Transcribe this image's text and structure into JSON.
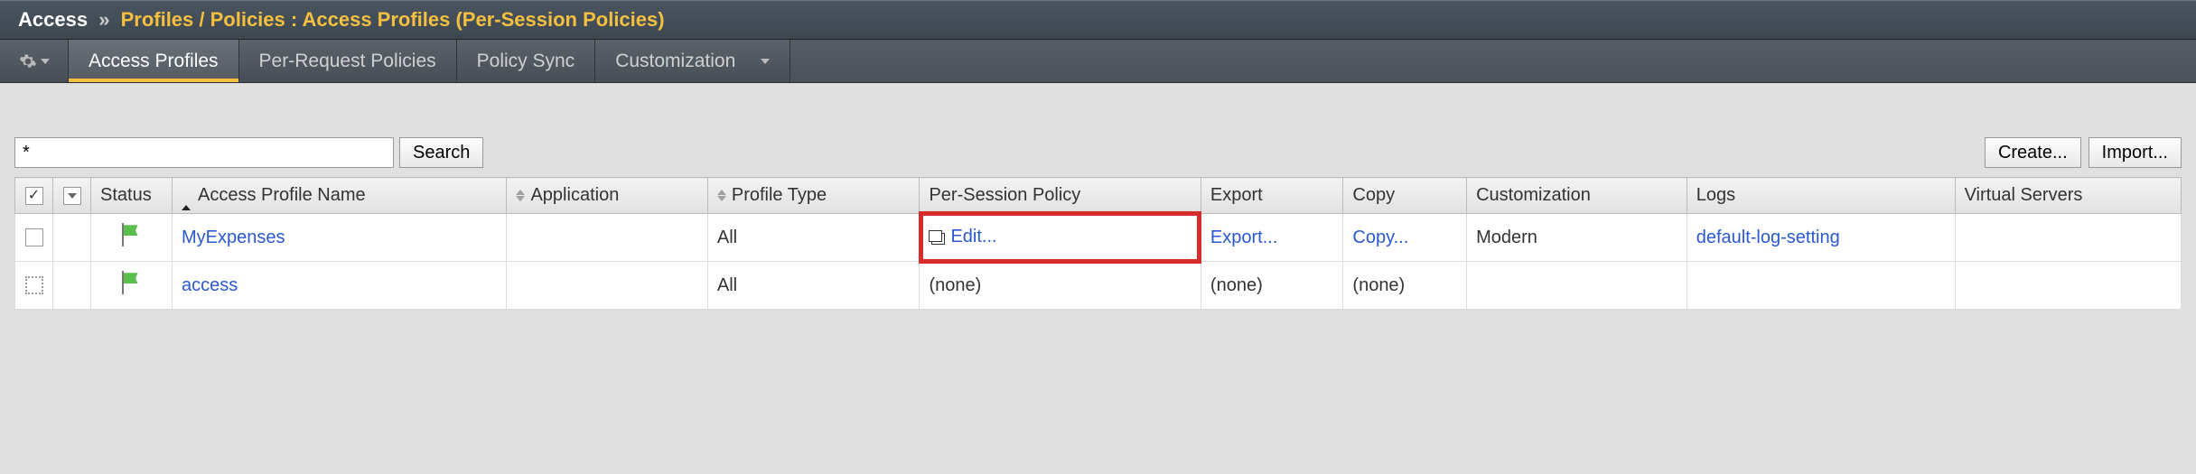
{
  "breadcrumb": {
    "root": "Access",
    "sep": "»",
    "path": "Profiles / Policies : Access Profiles (Per-Session Policies)"
  },
  "tabs": {
    "items": [
      {
        "label": "Access Profiles",
        "active": true,
        "has_dropdown": false
      },
      {
        "label": "Per-Request Policies",
        "active": false,
        "has_dropdown": false
      },
      {
        "label": "Policy Sync",
        "active": false,
        "has_dropdown": false
      },
      {
        "label": "Customization",
        "active": false,
        "has_dropdown": true
      }
    ]
  },
  "toolbar": {
    "search_value": "*",
    "search_button": "Search",
    "create_button": "Create...",
    "import_button": "Import..."
  },
  "table": {
    "columns": {
      "status": "Status",
      "name": "Access Profile Name",
      "application": "Application",
      "profile_type": "Profile Type",
      "per_session": "Per-Session Policy",
      "export": "Export",
      "copy": "Copy",
      "customization": "Customization",
      "logs": "Logs",
      "virtual_servers": "Virtual Servers"
    },
    "rows": [
      {
        "checkbox": "unchecked",
        "status": "green",
        "name": "MyExpenses",
        "application": "",
        "profile_type": "All",
        "per_session": "Edit...",
        "export": "Export...",
        "copy": "Copy...",
        "customization": "Modern",
        "logs": "default-log-setting",
        "virtual_servers": "",
        "highlight_edit": true
      },
      {
        "checkbox": "dotted",
        "status": "green",
        "name": "access",
        "application": "",
        "profile_type": "All",
        "per_session": "(none)",
        "export": "(none)",
        "copy": "(none)",
        "customization": "",
        "logs": "",
        "virtual_servers": "",
        "highlight_edit": false
      }
    ]
  }
}
